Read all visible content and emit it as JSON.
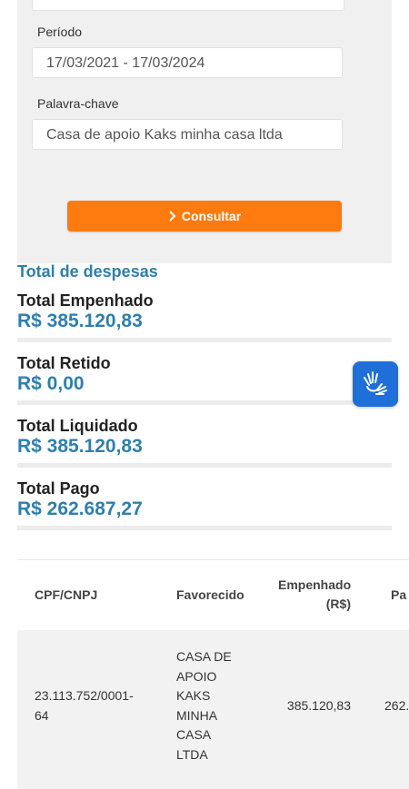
{
  "filters": {
    "periodo_label": "Período",
    "periodo_value": "17/03/2021 - 17/03/2024",
    "palavra_label": "Palavra-chave",
    "palavra_value": "Casa de apoio Kaks minha casa ltda",
    "consultar_label": "Consultar"
  },
  "totals": {
    "section_title": "Total de despesas",
    "items": [
      {
        "label": "Total Empenhado",
        "value": "R$ 385.120,83"
      },
      {
        "label": "Total Retido",
        "value": "R$ 0,00"
      },
      {
        "label": "Total Liquidado",
        "value": "R$ 385.120,83"
      },
      {
        "label": "Total Pago",
        "value": "R$ 262.687,27"
      }
    ]
  },
  "table": {
    "headers": {
      "cpf": "CPF/CNPJ",
      "favorecido": "Favorecido",
      "empenhado_1": "Empenhado",
      "empenhado_2": "(R$)",
      "pago": "Pa"
    },
    "rows": [
      {
        "cpf_1": "23.113.752/0001-",
        "cpf_2": "64",
        "favorecido_lines": [
          "CASA DE",
          "APOIO",
          "KAKS",
          "MINHA",
          "CASA",
          "LTDA"
        ],
        "empenhado": "385.120,83",
        "pago": "262."
      }
    ]
  },
  "colors": {
    "accent": "#2f7fae",
    "button": "#ff7a0f",
    "libras": "#1e6fd9"
  },
  "icons": {
    "consultar": "chevron-right-icon",
    "accessibility": "sign-language-icon"
  }
}
